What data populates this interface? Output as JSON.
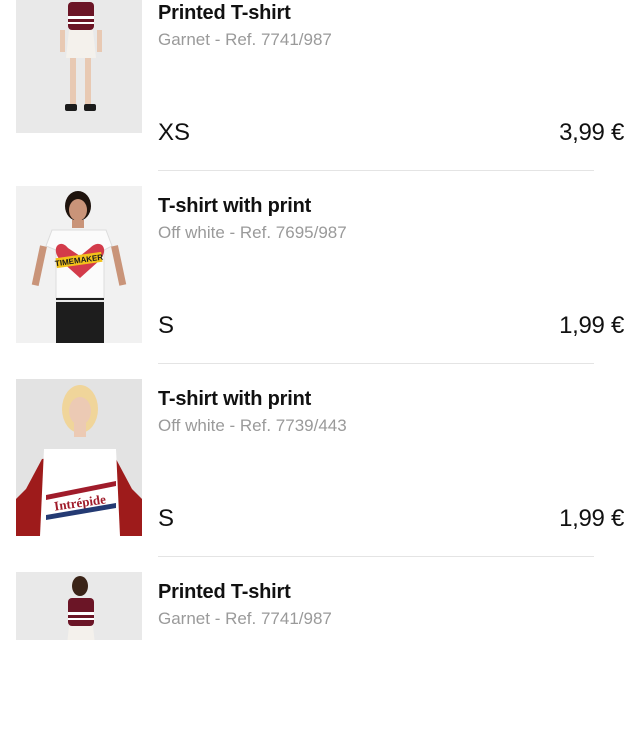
{
  "cart": {
    "items": [
      {
        "name": "Printed T-shirt",
        "color": "Garnet",
        "ref": "Ref. 7741/987",
        "subtitle": "Garnet - Ref. 7741/987",
        "size": "XS",
        "price": "3,99 €",
        "image": "woman-garnet-tshirt-white-skirt"
      },
      {
        "name": "T-shirt with print",
        "color": "Off white",
        "ref": "Ref. 7695/987",
        "subtitle": "Off white - Ref. 7695/987",
        "size": "S",
        "price": "1,99 €",
        "image": "woman-white-tshirt-heart-print",
        "print_text": "TIMEMAKER"
      },
      {
        "name": "T-shirt with print",
        "color": "Off white",
        "ref": "Ref. 7739/443",
        "subtitle": "Off white - Ref. 7739/443",
        "size": "S",
        "price": "1,99 €",
        "image": "woman-white-tshirt-intrepide-print",
        "print_text": "Intrépide"
      },
      {
        "name": "Printed T-shirt",
        "color": "Garnet",
        "ref": "Ref. 7741/987",
        "subtitle": "Garnet - Ref. 7741/987",
        "image": "woman-garnet-tshirt-white-skirt"
      }
    ]
  },
  "colors": {
    "garnet": "#6b1526",
    "text_secondary": "#9a9a9a",
    "divider": "#e4e4e4"
  }
}
